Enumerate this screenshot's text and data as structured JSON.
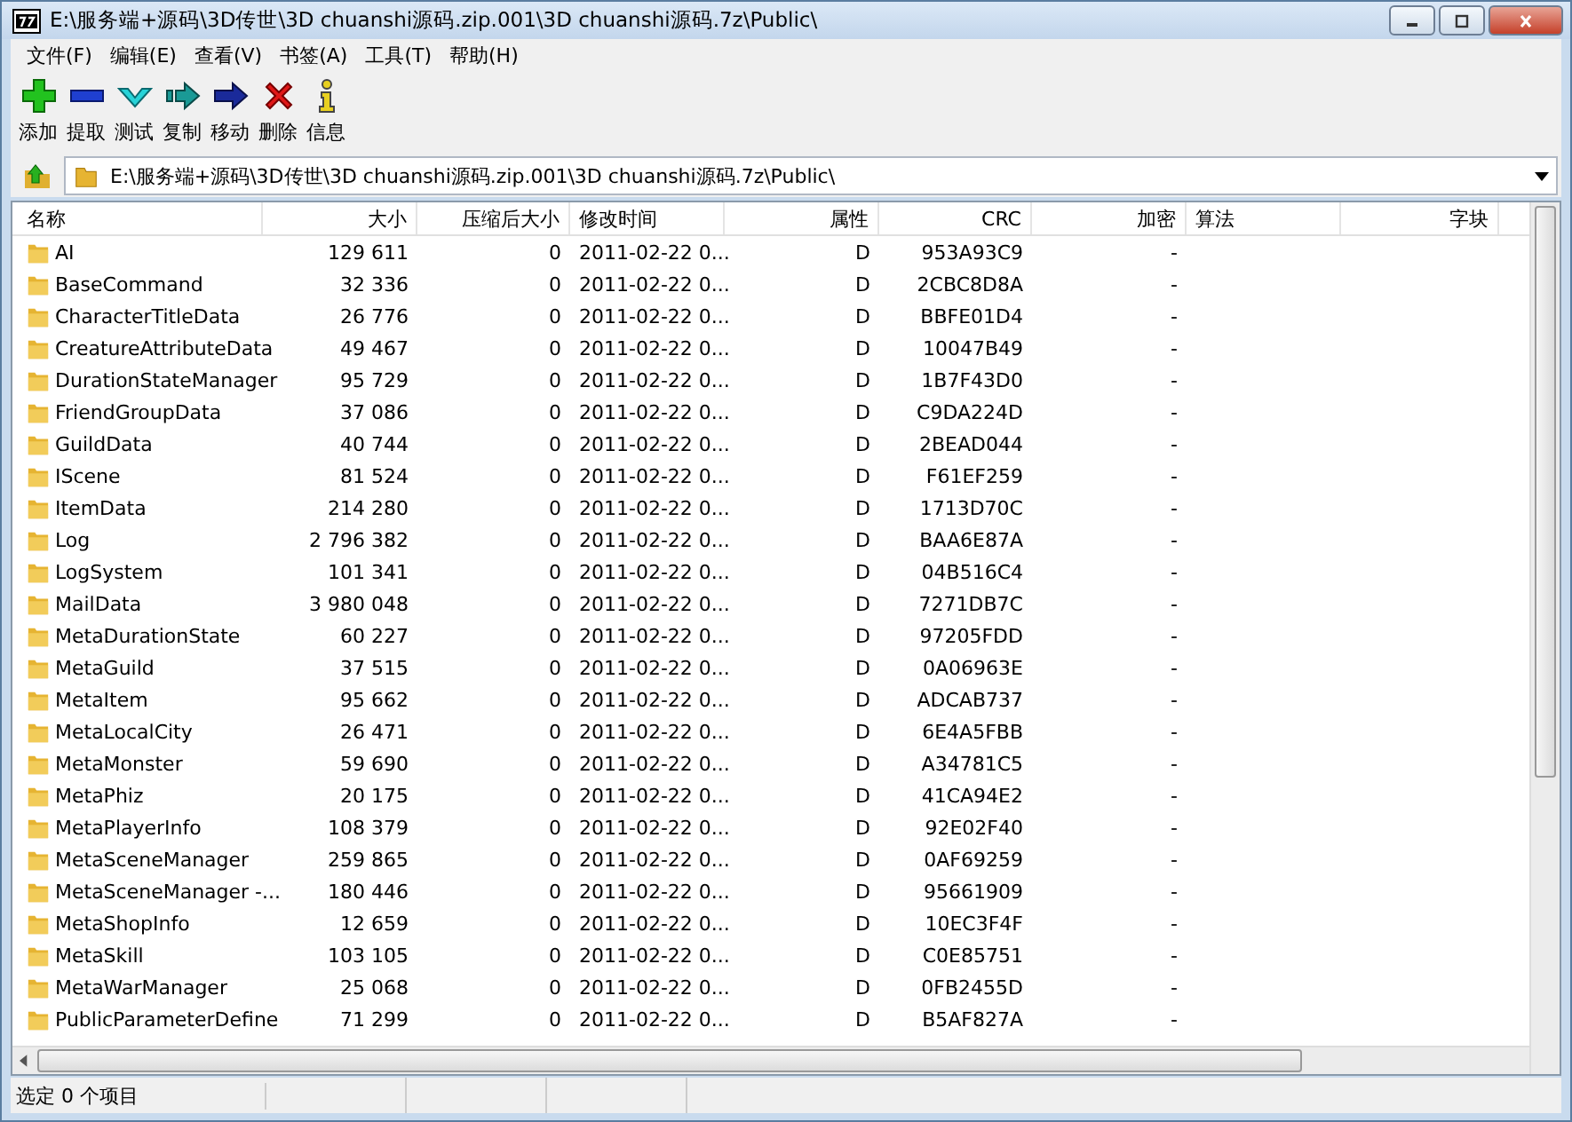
{
  "window": {
    "title": "E:\\服务端+源码\\3D传世\\3D chuanshi源码.zip.001\\3D chuanshi源码.7z\\Public\\"
  },
  "menu": [
    "文件(F)",
    "编辑(E)",
    "查看(V)",
    "书签(A)",
    "工具(T)",
    "帮助(H)"
  ],
  "toolbar": [
    {
      "kind": "add",
      "label": "添加"
    },
    {
      "kind": "extract",
      "label": "提取"
    },
    {
      "kind": "test",
      "label": "测试"
    },
    {
      "kind": "copy",
      "label": "复制"
    },
    {
      "kind": "move",
      "label": "移动"
    },
    {
      "kind": "delete",
      "label": "删除"
    },
    {
      "kind": "info",
      "label": "信息"
    }
  ],
  "address": {
    "path": "E:\\服务端+源码\\3D传世\\3D chuanshi源码.zip.001\\3D chuanshi源码.7z\\Public\\"
  },
  "table": {
    "columns": [
      "名称",
      "大小",
      "压缩后大小",
      "修改时间",
      "属性",
      "CRC",
      "加密",
      "算法",
      "字块"
    ],
    "rows": [
      [
        "AI",
        "129 611",
        "0",
        "2011-02-22 0...",
        "D",
        "953A93C9",
        "-"
      ],
      [
        "BaseCommand",
        "32 336",
        "0",
        "2011-02-22 0...",
        "D",
        "2CBC8D8A",
        "-"
      ],
      [
        "CharacterTitleData",
        "26 776",
        "0",
        "2011-02-22 0...",
        "D",
        "BBFE01D4",
        "-"
      ],
      [
        "CreatureAttributeData",
        "49 467",
        "0",
        "2011-02-22 0...",
        "D",
        "10047B49",
        "-"
      ],
      [
        "DurationStateManager",
        "95 729",
        "0",
        "2011-02-22 0...",
        "D",
        "1B7F43D0",
        "-"
      ],
      [
        "FriendGroupData",
        "37 086",
        "0",
        "2011-02-22 0...",
        "D",
        "C9DA224D",
        "-"
      ],
      [
        "GuildData",
        "40 744",
        "0",
        "2011-02-22 0...",
        "D",
        "2BEAD044",
        "-"
      ],
      [
        "IScene",
        "81 524",
        "0",
        "2011-02-22 0...",
        "D",
        "F61EF259",
        "-"
      ],
      [
        "ItemData",
        "214 280",
        "0",
        "2011-02-22 0...",
        "D",
        "1713D70C",
        "-"
      ],
      [
        "Log",
        "2 796 382",
        "0",
        "2011-02-22 0...",
        "D",
        "BAA6E87A",
        "-"
      ],
      [
        "LogSystem",
        "101 341",
        "0",
        "2011-02-22 0...",
        "D",
        "04B516C4",
        "-"
      ],
      [
        "MailData",
        "3 980 048",
        "0",
        "2011-02-22 0...",
        "D",
        "7271DB7C",
        "-"
      ],
      [
        "MetaDurationState",
        "60 227",
        "0",
        "2011-02-22 0...",
        "D",
        "97205FDD",
        "-"
      ],
      [
        "MetaGuild",
        "37 515",
        "0",
        "2011-02-22 0...",
        "D",
        "0A06963E",
        "-"
      ],
      [
        "MetaItem",
        "95 662",
        "0",
        "2011-02-22 0...",
        "D",
        "ADCAB737",
        "-"
      ],
      [
        "MetaLocalCity",
        "26 471",
        "0",
        "2011-02-22 0...",
        "D",
        "6E4A5FBB",
        "-"
      ],
      [
        "MetaMonster",
        "59 690",
        "0",
        "2011-02-22 0...",
        "D",
        "A34781C5",
        "-"
      ],
      [
        "MetaPhiz",
        "20 175",
        "0",
        "2011-02-22 0...",
        "D",
        "41CA94E2",
        "-"
      ],
      [
        "MetaPlayerInfo",
        "108 379",
        "0",
        "2011-02-22 0...",
        "D",
        "92E02F40",
        "-"
      ],
      [
        "MetaSceneManager",
        "259 865",
        "0",
        "2011-02-22 0...",
        "D",
        "0AF69259",
        "-"
      ],
      [
        "MetaSceneManager -...",
        "180 446",
        "0",
        "2011-02-22 0...",
        "D",
        "95661909",
        "-"
      ],
      [
        "MetaShopInfo",
        "12 659",
        "0",
        "2011-02-22 0...",
        "D",
        "10EC3F4F",
        "-"
      ],
      [
        "MetaSkill",
        "103 105",
        "0",
        "2011-02-22 0...",
        "D",
        "C0E85751",
        "-"
      ],
      [
        "MetaWarManager",
        "25 068",
        "0",
        "2011-02-22 0...",
        "D",
        "0FB2455D",
        "-"
      ],
      [
        "PublicParameterDefine",
        "71 299",
        "0",
        "2011-02-22 0...",
        "D",
        "B5AF827A",
        "-"
      ]
    ]
  },
  "status_bar": "选定 0 个项目"
}
